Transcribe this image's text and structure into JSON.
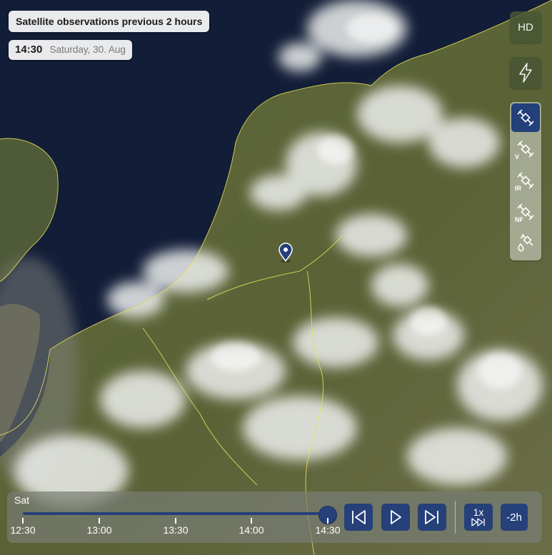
{
  "header": {
    "title": "Satellite observations previous 2 hours",
    "time": "14:30",
    "date": "Saturday, 30. Aug"
  },
  "side_controls": {
    "hd_label": "HD",
    "lightning_icon": "lightning-icon",
    "satellite_modes": [
      {
        "icon": "satellite-icon",
        "sub": "",
        "active": true
      },
      {
        "icon": "satellite-icon",
        "sub": "V",
        "active": false
      },
      {
        "icon": "satellite-icon",
        "sub": "IR",
        "active": false
      },
      {
        "icon": "satellite-icon",
        "sub": "NF",
        "active": false
      },
      {
        "icon": "satellite-drop-icon",
        "sub": "",
        "active": false
      }
    ]
  },
  "timeline": {
    "day_label": "Sat",
    "ticks": [
      "12:30",
      "13:00",
      "13:30",
      "14:00",
      "14:30"
    ],
    "current": "14:30",
    "speed_label": "1x",
    "range_label": "-2h"
  },
  "colors": {
    "accent": "#26407a",
    "sea": "#111c36",
    "land": "#5b6638",
    "border": "#e7df55"
  }
}
